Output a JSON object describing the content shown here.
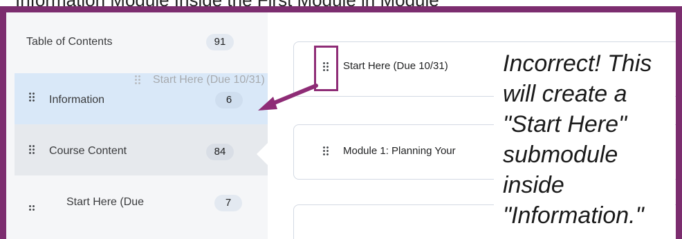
{
  "caption_top": "Information Module Inside the First Module in Module",
  "sidebar": {
    "toc_label": "Table of Contents",
    "toc_count": "91",
    "items": [
      {
        "label": "Information",
        "count": "6"
      },
      {
        "label": "Course Content",
        "count": "84"
      },
      {
        "label": "Start Here (Due",
        "count": "7"
      }
    ]
  },
  "drag_ghost": {
    "label": "Start Here (Due 10/31)"
  },
  "cards": [
    {
      "title": "Start Here (Due 10/31)"
    },
    {
      "title": "Module 1: Planning Your"
    },
    {
      "title": ""
    }
  ],
  "annotation": {
    "text": "Incorrect! This will create a \"Start Here\" submodule inside \"Information.\""
  },
  "colors": {
    "frame": "#7c2d6f",
    "highlight": "#8e2c76",
    "selected_row": "#d9e8f8",
    "sidebar": "#f5f6f8"
  },
  "icons": {
    "drag_handle": "grip-dots-icon",
    "arrow": "arrow-icon"
  }
}
